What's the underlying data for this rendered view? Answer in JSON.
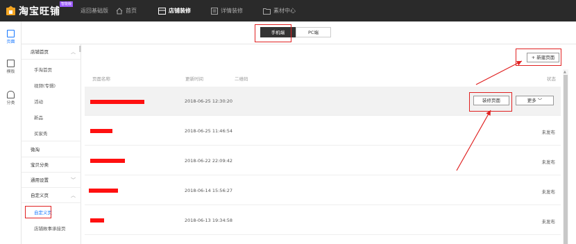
{
  "topbar": {
    "app_name": "淘宝旺铺",
    "badge": "智能版",
    "nav": [
      {
        "label": "返回基础版"
      },
      {
        "label": "首页"
      },
      {
        "label": "店铺装修"
      },
      {
        "label": "详情装修"
      },
      {
        "label": "素材中心"
      }
    ]
  },
  "rail": [
    {
      "label": "页面",
      "icon": "page-icon"
    },
    {
      "label": "模板",
      "icon": "template-icon"
    },
    {
      "label": "分类",
      "icon": "category-icon"
    }
  ],
  "sidebar": {
    "items": [
      {
        "label": "店铺首页",
        "chevron": "︿",
        "type": "group"
      },
      {
        "label": "手淘首页",
        "type": "sub"
      },
      {
        "label": "视频(专辑)",
        "type": "sub"
      },
      {
        "label": "活动",
        "type": "sub"
      },
      {
        "label": "新品",
        "type": "sub"
      },
      {
        "label": "买家秀",
        "type": "sub"
      },
      {
        "label": "微淘",
        "type": "group"
      },
      {
        "label": "宝贝分类",
        "type": "group"
      },
      {
        "label": "通用设置",
        "chevron": "﹀",
        "type": "group"
      },
      {
        "label": "自定义页",
        "chevron": "︿",
        "type": "group"
      },
      {
        "label": "自定义页",
        "type": "sub",
        "selected": true
      },
      {
        "label": "店铺故事承接页",
        "type": "sub"
      }
    ]
  },
  "segment": {
    "mobile": "手机端",
    "pc": "PC端"
  },
  "toolbar": {
    "new_page": "+ 新建页面"
  },
  "table": {
    "headers": {
      "name": "页面名称",
      "updated": "更新时间",
      "qrcode": "二维码",
      "status": "状态"
    },
    "rows": [
      {
        "updated": "2018-06-25 12:30:20",
        "status": "",
        "actions": {
          "decorate": "装修页面",
          "more": "更多 ﹀"
        }
      },
      {
        "updated": "2018-06-25 11:46:54",
        "status": "未发布"
      },
      {
        "updated": "2018-06-22 22:09:42",
        "status": "未发布"
      },
      {
        "updated": "2018-06-14 15:56:27",
        "status": "未发布"
      },
      {
        "updated": "2018-06-13 19:34:58",
        "status": "未发布"
      }
    ]
  },
  "colors": {
    "topbar": "#2a2a2a",
    "accent": "#1677ff",
    "annotation": "#e02020",
    "redaction": "#ff1010"
  }
}
